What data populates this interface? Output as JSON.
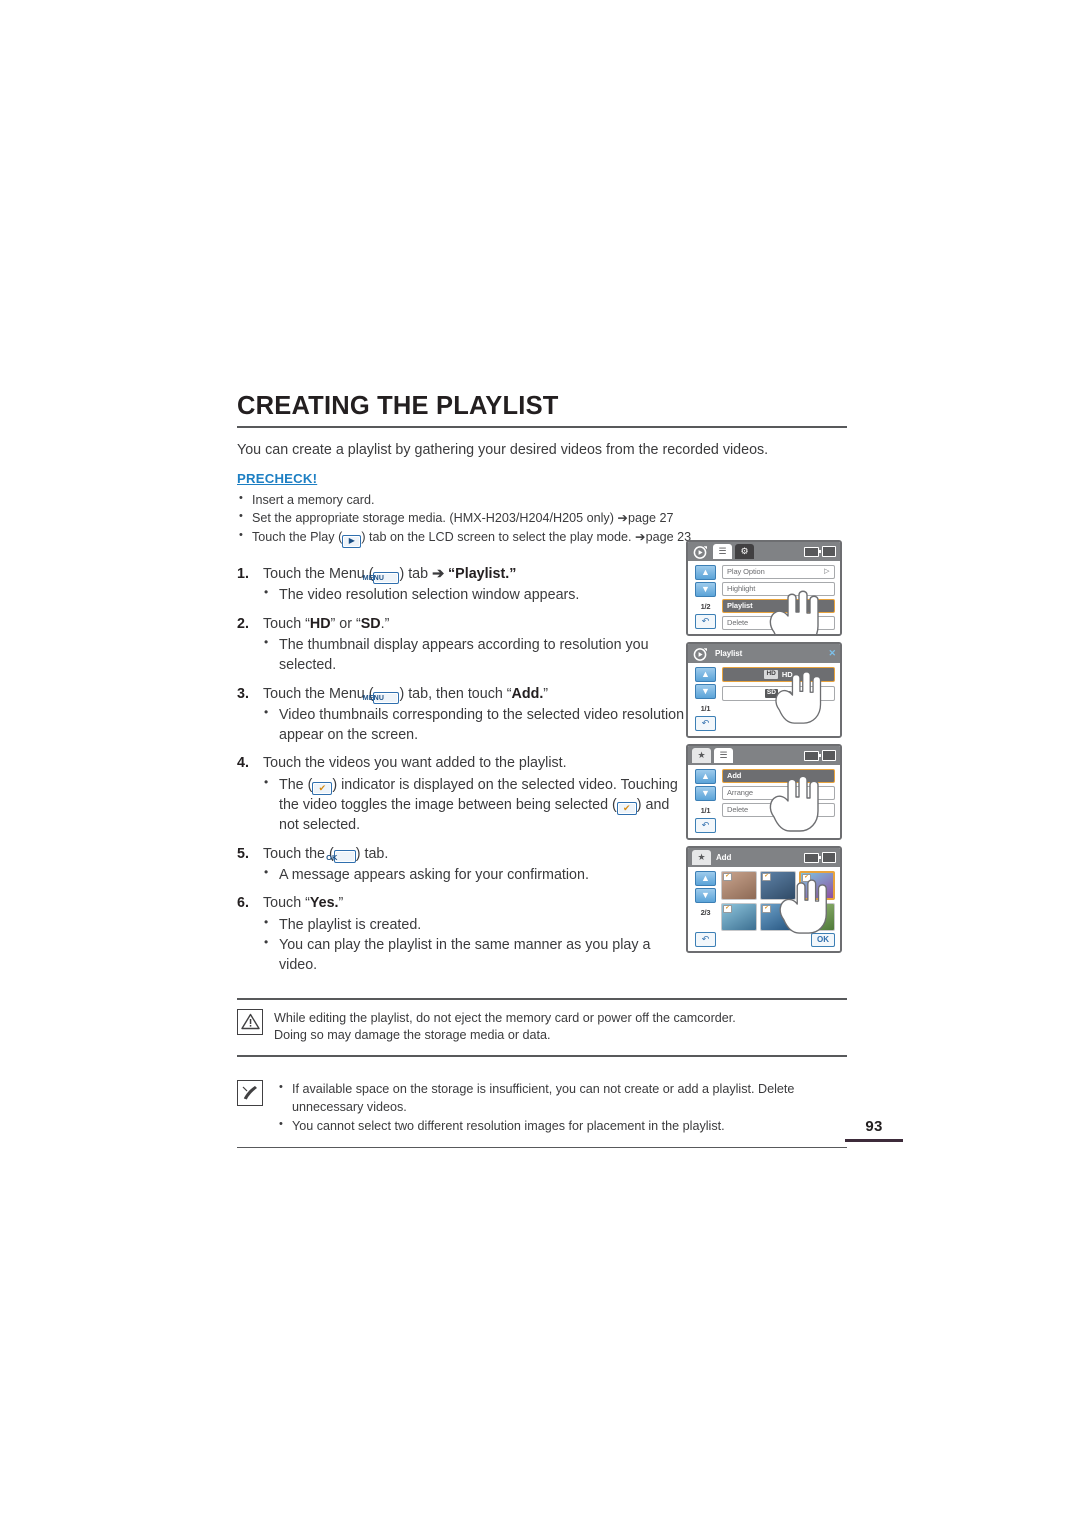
{
  "document": {
    "title": "CREATING THE PLAYLIST",
    "intro": "You can create a playlist by gathering your desired videos from the recorded videos.",
    "page_number": "93"
  },
  "precheck": {
    "label": "PRECHECK!",
    "items": [
      "Insert a memory card.",
      "Set the appropriate storage media. (HMX-H203/H204/H205 only) ➔page 27",
      "Touch the Play (PLAY_ICON) tab on the LCD screen to select the play mode. ➔page 23"
    ],
    "item2_text": "Set the appropriate storage media. (HMX-H203/H204/H205 only) ",
    "item2_ref": "➔page 27",
    "item3_pre": "Touch the Play (",
    "item3_post": ") tab on the LCD screen to select the play mode. ",
    "item3_ref": "➔page 23",
    "item1": "Insert a memory card."
  },
  "steps": [
    {
      "num": "1.",
      "pre": "Touch the Menu (",
      "icon": "MENU",
      "post": ") tab ",
      "arrow": "➔",
      "bold_tail": "“Playlist.”",
      "bullets": [
        "The video resolution selection window appears."
      ]
    },
    {
      "num": "2.",
      "pre": "Touch “",
      "bold_a": "HD",
      "mid": "” or “",
      "bold_b": "SD",
      "post": ".”",
      "bullets": [
        "The thumbnail display appears according to resolution you selected."
      ]
    },
    {
      "num": "3.",
      "pre": "Touch the Menu (",
      "icon": "MENU",
      "post": ") tab, then touch “",
      "bold_tail": "Add.",
      "tail2": "”",
      "bullets": [
        "Video thumbnails corresponding to the selected video resolution appear on the screen."
      ]
    },
    {
      "num": "4.",
      "text": "Touch the videos you want added to the playlist.",
      "bullet_pre": "The (",
      "bullet_mid": ") indicator is displayed on the selected video. Touching the video toggles the image between being selected (",
      "bullet_post": ") and not selected."
    },
    {
      "num": "5.",
      "pre": "Touch the (",
      "icon": "OK",
      "post": ") tab.",
      "bullets": [
        "A message appears asking for your confirmation."
      ]
    },
    {
      "num": "6.",
      "pre": "Touch “",
      "bold_tail": "Yes.",
      "tail2": "”",
      "bullets": [
        "The playlist is created.",
        "You can play the playlist in the same manner as you play a video."
      ]
    }
  ],
  "lcd_panels": [
    {
      "id": "menu-playlist",
      "topbar": {
        "mode_icon": "play-mode-icon",
        "tabs": [
          "list-tab",
          "gear-tab"
        ],
        "battery": "battery-icon",
        "card": "card-icon"
      },
      "page_indicator": "1/2",
      "up_label": "▲",
      "down_label": "▼",
      "back_label": "↶",
      "rows": [
        {
          "label": "Play Option",
          "right": "▷",
          "selected": false
        },
        {
          "label": "Highlight",
          "right": "",
          "selected": false
        },
        {
          "label": "Playlist",
          "right": "",
          "selected": true
        },
        {
          "label": "Delete",
          "right": "",
          "selected": false
        }
      ]
    },
    {
      "id": "playlist-resolution",
      "title": "Playlist",
      "close_label": "✕",
      "page_indicator": "1/1",
      "up_label": "▲",
      "down_label": "▼",
      "back_label": "↶",
      "resolutions": [
        {
          "badge": "HD",
          "label": "HD",
          "selected": true
        },
        {
          "badge": "SD",
          "label": "SD",
          "selected": false
        }
      ]
    },
    {
      "id": "playlist-menu-add",
      "topbar": {
        "mode_icon": "playlist-mode-icon",
        "tabs": [
          "list-tab"
        ],
        "battery": "battery-icon",
        "card": "card-icon"
      },
      "page_indicator": "1/1",
      "up_label": "▲",
      "down_label": "▼",
      "back_label": "↶",
      "rows": [
        {
          "label": "Add",
          "right": "",
          "selected": true
        },
        {
          "label": "Arrange",
          "right": "",
          "selected": false
        },
        {
          "label": "Delete",
          "right": "",
          "selected": false
        }
      ]
    },
    {
      "id": "add-thumbnails",
      "title": "Add",
      "page_indicator": "2/3",
      "up_label": "▲",
      "down_label": "▼",
      "back_label": "↶",
      "ok_label": "OK",
      "thumbnails": [
        {
          "check": "✔",
          "selected": false,
          "c1": "#c9a48e",
          "c2": "#8d6a55"
        },
        {
          "check": "✔",
          "selected": false,
          "c1": "#5f83a8",
          "c2": "#2f4a66"
        },
        {
          "check": "✔",
          "selected": true,
          "c1": "#7fc4e0",
          "c2": "#8e4fa0"
        },
        {
          "check": "✔",
          "selected": false,
          "c1": "#8fc6dd",
          "c2": "#3c6f91"
        },
        {
          "check": "✔",
          "selected": false,
          "c1": "#6ea3cb",
          "c2": "#24527d"
        },
        {
          "check": "✔",
          "selected": false,
          "c1": "#9fbf7a",
          "c2": "#4f7a3a"
        }
      ]
    }
  ],
  "notes": {
    "caution": {
      "icon": "warning-icon",
      "line1": "While editing the playlist, do not eject the memory card or power off the camcorder.",
      "line2": "Doing so may damage the storage media or data."
    },
    "tip": {
      "icon": "note-pen-icon",
      "items": [
        "If available space on the storage is insufficient, you can not create or add a playlist. Delete unnecessary videos.",
        "You cannot select two different resolution images for placement in the playlist."
      ]
    }
  },
  "colors": {
    "accent_blue": "#1d7fc3",
    "selection_orange": "#e8a33d",
    "text": "#3b3b3d",
    "bar_gray": "#808285"
  }
}
